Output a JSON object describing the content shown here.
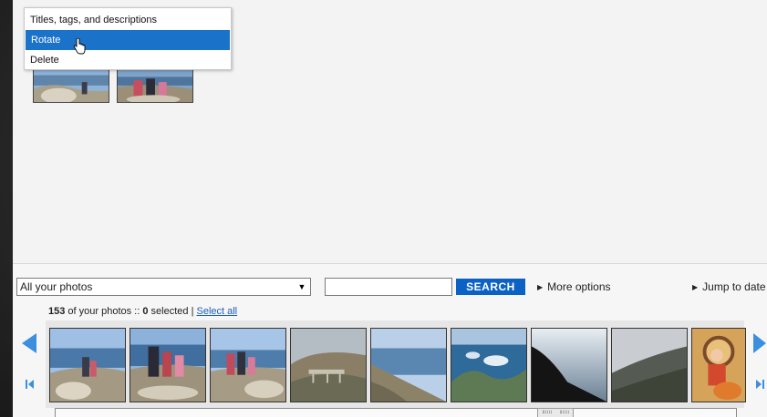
{
  "context_menu": {
    "items": [
      {
        "label": "Titles, tags, and descriptions",
        "active": false
      },
      {
        "label": "Rotate",
        "active": true
      },
      {
        "label": "Delete",
        "active": false
      }
    ]
  },
  "filter": {
    "selected": "All your photos"
  },
  "search": {
    "value": "",
    "button_label": "SEARCH"
  },
  "more_options_label": "More options",
  "jump_to_date_label": "Jump to date",
  "status": {
    "count": "153",
    "count_suffix": " of your photos :: ",
    "selected": "0",
    "selected_suffix": " selected | ",
    "select_all": "Select all"
  },
  "colors": {
    "accent": "#0b62c4",
    "menu_highlight": "#1a73c9",
    "nav_arrow": "#3c8fde"
  },
  "icons": {
    "menu_cursor": "hand-pointer-icon",
    "filter_dropdown": "chevron-down-icon",
    "nav_prev": "arrow-left-icon",
    "nav_next": "arrow-right-icon",
    "nav_first": "skip-first-icon",
    "nav_last": "skip-last-icon"
  }
}
